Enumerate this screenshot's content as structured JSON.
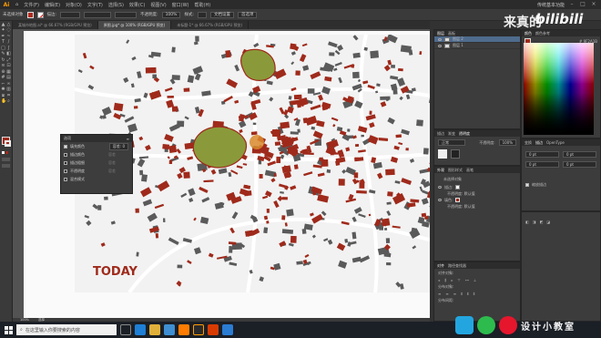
{
  "app": {
    "name_abbr": "Ai",
    "menus": [
      "文件(F)",
      "编辑(E)",
      "对象(O)",
      "文字(T)",
      "选择(S)",
      "效果(C)",
      "视图(V)",
      "窗口(W)",
      "帮助(H)"
    ],
    "workspace": "传统基本功能"
  },
  "control": {
    "no_selection": "未选择对象",
    "stroke_label": "描边:",
    "opacity_label": "不透明度:",
    "opacity_value": "100%",
    "style_label": "样式:",
    "doc_setup": "文档设置",
    "prefs": "首选项"
  },
  "tabs": [
    {
      "label": "某城市地图.ai* @ 66.67% (RGB/GPU 预览)",
      "active": false
    },
    {
      "label": "原图.jpg* @ 100% (RGB/GPU 预览)",
      "active": true
    },
    {
      "label": "未标题-1* @ 66.67% (RGB/GPU 预览)",
      "active": false
    }
  ],
  "popup": {
    "title": "选项",
    "items": [
      {
        "label": "填充颜色",
        "checked": true,
        "value": "容差: 0"
      },
      {
        "label": "描边颜色",
        "checked": false,
        "value": "容差"
      },
      {
        "label": "描边粗细",
        "checked": false,
        "value": "容差"
      },
      {
        "label": "不透明度",
        "checked": false,
        "value": "容差"
      },
      {
        "label": "混合模式",
        "checked": false,
        "value": ""
      }
    ]
  },
  "layers": {
    "tabs": [
      "图层",
      "画板"
    ],
    "rows": [
      {
        "name": "图层 2",
        "selected": true
      },
      {
        "name": "图层 1",
        "selected": false
      }
    ]
  },
  "transparency": {
    "tabs": [
      "描边",
      "渐变",
      "透明度"
    ],
    "mode": "正常",
    "opacity": "100%"
  },
  "appearance": {
    "tabs": [
      "外观",
      "图形样式",
      "画笔"
    ],
    "title": "未选择对象",
    "rows": [
      "描边:",
      "不透明度: 默认值",
      "填色:",
      "不透明度: 默认值"
    ]
  },
  "align": {
    "tabs": [
      "对齐",
      "路径查找器"
    ],
    "sections": [
      "对齐对象:",
      "分布对象:",
      "分布间距:"
    ]
  },
  "color": {
    "tabs": [
      "颜色",
      "颜色参考"
    ],
    "hex": "# 9F2A1B"
  },
  "properties": {
    "tabs": [
      "变换",
      "描边",
      "OpenType"
    ],
    "fields": [
      "0 pt",
      "0 pt",
      "0 pt",
      "0 pt"
    ],
    "check_label": "缩放描边"
  },
  "status": {
    "zoom": "100%",
    "tool": "选择"
  },
  "taskbar": {
    "search_placeholder": "在这里输入你要搜索的内容"
  },
  "canvas_text": {
    "map_label": "TODAY"
  },
  "watermark": {
    "top_text": "来真的",
    "logo_text": "bilibili",
    "bottom_text": "设计小教室"
  },
  "colors": {
    "building": "#9f2a1b",
    "building_grey": "#5a5a5a",
    "park": "#8a9a3a",
    "highlight": "#d98a2b"
  }
}
